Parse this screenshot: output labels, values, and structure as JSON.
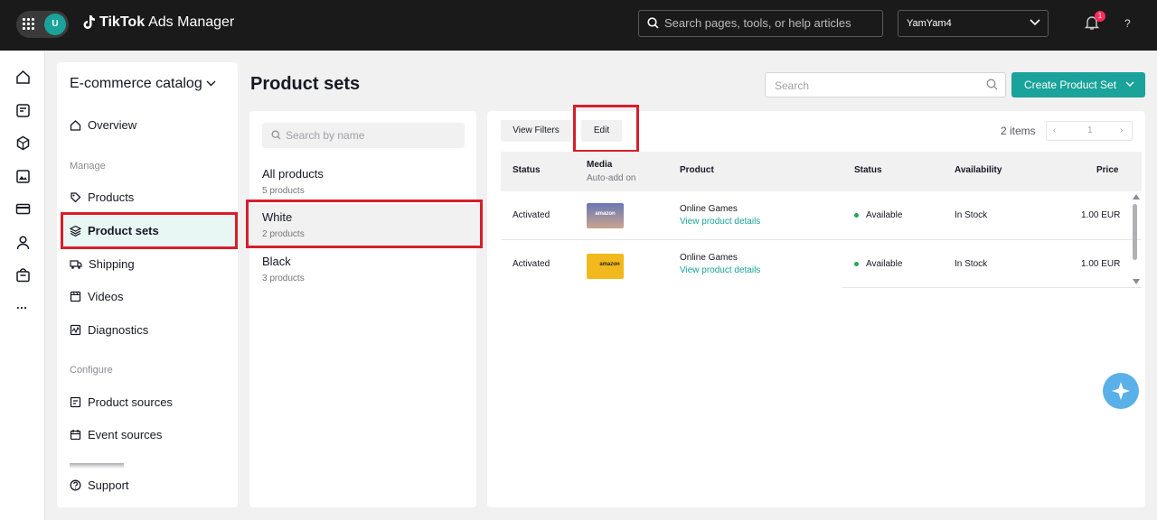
{
  "topbar": {
    "avatar_initial": "U",
    "brand_main": "TikTok",
    "brand_sub": "Ads Manager",
    "search_placeholder": "Search pages, tools, or help articles",
    "account": "YamYam4",
    "notification_count": "1",
    "help": "?"
  },
  "rail": {
    "icons": [
      "home-icon",
      "campaign-icon",
      "catalog-cube-icon",
      "assets-icon",
      "payment-card-icon",
      "user-icon",
      "shop-bag-icon"
    ],
    "more": "..."
  },
  "sidebar": {
    "catalog_name": "E-commerce catalog",
    "overview": "Overview",
    "manage_label": "Manage",
    "manage_items": [
      "Products",
      "Product sets",
      "Shipping",
      "Videos",
      "Diagnostics"
    ],
    "configure_label": "Configure",
    "configure_items": [
      "Product sources",
      "Event sources"
    ],
    "support": "Support"
  },
  "page": {
    "title": "Product sets",
    "search_placeholder": "Search",
    "create_button": "Create Product Set"
  },
  "sets": {
    "search_placeholder": "Search by name",
    "items": [
      {
        "name": "All products",
        "count": "5 products"
      },
      {
        "name": "White",
        "count": "2 products"
      },
      {
        "name": "Black",
        "count": "3 products"
      }
    ]
  },
  "toolbar": {
    "view_filters": "View Filters",
    "edit": "Edit",
    "items_count": "2 items",
    "page": "1"
  },
  "table": {
    "headers": {
      "status": "Status",
      "media": "Media",
      "media_sub": "Auto-add on",
      "product": "Product",
      "status2": "Status",
      "availability": "Availability",
      "price": "Price"
    },
    "rows": [
      {
        "status": "Activated",
        "thumb_text": "amazon",
        "product": "Online Games",
        "link": "View product details",
        "state": "Available",
        "availability": "In Stock",
        "price": "1.00 EUR"
      },
      {
        "status": "Activated",
        "thumb_text": "amazon",
        "product": "Online Games",
        "link": "View product details",
        "state": "Available",
        "availability": "In Stock",
        "price": "1.00 EUR"
      }
    ]
  },
  "colors": {
    "accent": "#1aa39a",
    "highlight": "#d61f2b",
    "topbar": "#1a1a1a"
  }
}
